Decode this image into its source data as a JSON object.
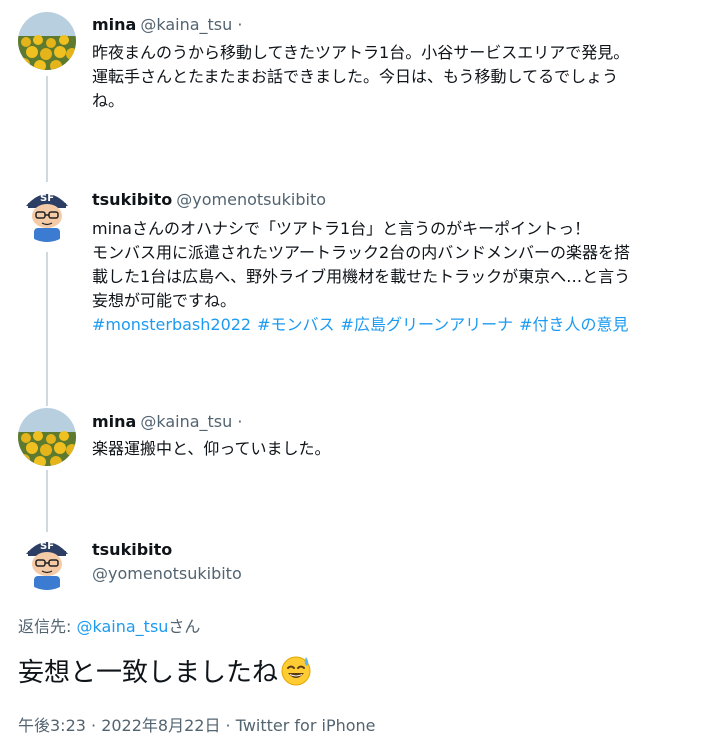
{
  "tweets": [
    {
      "name": "mina",
      "handle": "@kaina_tsu ·",
      "lines": [
        "昨夜まんのうから移動してきたツアトラ1台。小谷サービスエリアで発見。",
        "運転手さんとたまたまお話できました。今日は、もう移動してるでしょう",
        "ね。"
      ],
      "avatar_icon": "sunflower-field-avatar"
    },
    {
      "name": "tsukibito",
      "handle": "@yomenotsukibito",
      "lines": [
        "minaさんのオハナシで「ツアトラ1台」と言うのがキーポイントっ！",
        "モンバス用に派遣されたツアートラック2台の内バンドメンバーの楽器を搭",
        "載した1台は広島へ、野外ライブ用機材を載せたトラックが東京へ…と言う",
        "妄想が可能ですね。"
      ],
      "hashtags": [
        "#monsterbash2022",
        "#モンバス",
        "#広島グリーンアリーナ",
        "#付き人の意見"
      ],
      "avatar_icon": "cartoon-boy-cap-avatar"
    },
    {
      "name": "mina",
      "handle": "@kaina_tsu ·",
      "lines": [
        "楽器運搬中と、仰っていました。"
      ],
      "avatar_icon": "sunflower-field-avatar"
    }
  ],
  "main_tweet": {
    "name": "tsukibito",
    "handle": "@yomenotsukibito",
    "reply_prefix": "返信先: ",
    "reply_handle": "@kaina_tsu",
    "reply_suffix": "さん",
    "text": "妄想と一致しましたね",
    "emoji": "sweat-smile-emoji",
    "meta": "午後3:23 · 2022年8月22日 · Twitter for iPhone"
  },
  "colors": {
    "link": "#1d9bf0",
    "secondary": "#536471",
    "thread_line": "#cfd9de"
  }
}
